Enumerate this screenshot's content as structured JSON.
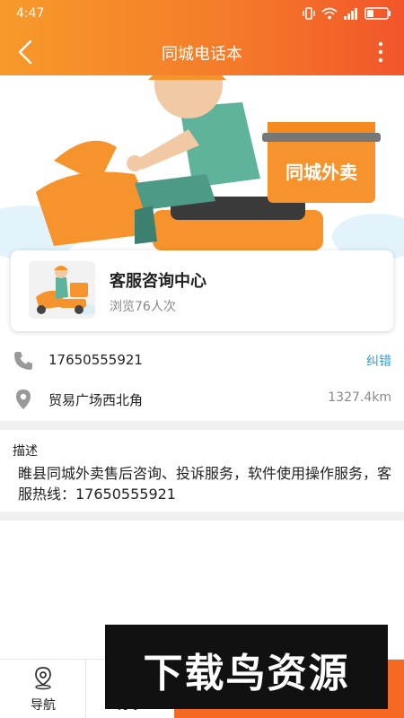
{
  "status_bar": {
    "time": "4:47"
  },
  "app_bar": {
    "title": "同城电话本"
  },
  "banner": {
    "box_label": "同城外卖"
  },
  "card": {
    "title": "客服咨询中心",
    "views": "浏览76人次"
  },
  "contact": {
    "phone": "17650555921",
    "correction_label": "纠错",
    "address": "贸易广场西北角",
    "distance": "1327.4km"
  },
  "description": {
    "title": "描述",
    "text": "睢县同城外卖售后咨询、投诉服务，软件使用操作服务，客服热线：17650555921"
  },
  "bottom_bar": {
    "nav_label": "导航",
    "share_label": "分享"
  },
  "watermark": {
    "text": "下载鸟资源"
  },
  "colors": {
    "accent": "#f4792a",
    "link": "#2ea0d8"
  }
}
